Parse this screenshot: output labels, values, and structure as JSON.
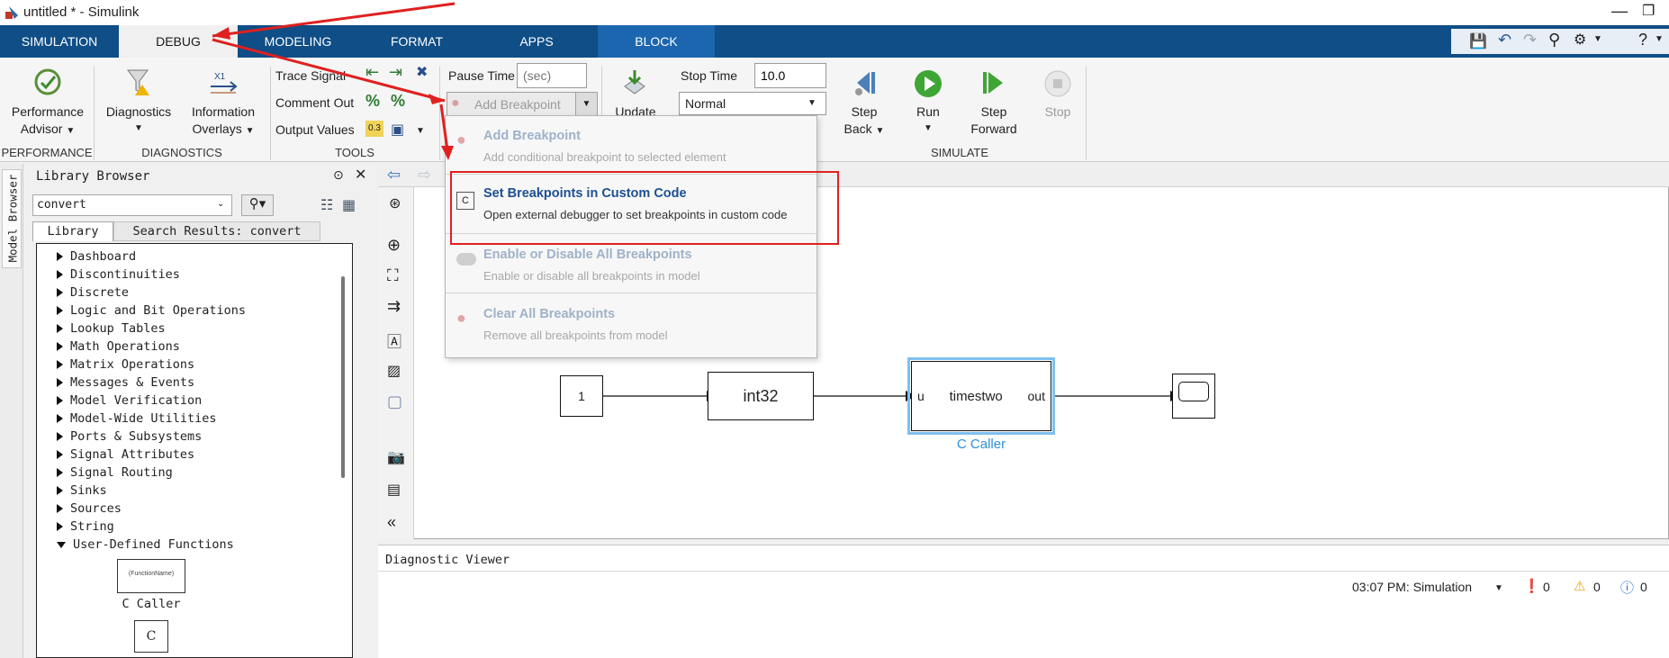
{
  "window": {
    "title": "untitled * - Simulink"
  },
  "tabs": [
    {
      "label": "SIMULATION"
    },
    {
      "label": "DEBUG"
    },
    {
      "label": "MODELING"
    },
    {
      "label": "FORMAT"
    },
    {
      "label": "APPS"
    },
    {
      "label": "BLOCK"
    }
  ],
  "ribbon": {
    "performance_advisor": "Performance\nAdvisor",
    "performance_advisor_l1": "Performance",
    "performance_advisor_l2": "Advisor",
    "diagnostics": "Diagnostics",
    "info_overlays_l1": "Information",
    "info_overlays_l2": "Overlays",
    "trace_signal": "Trace Signal",
    "comment_out": "Comment Out",
    "output_values": "Output Values",
    "pause_time_label": "Pause Time",
    "pause_time_placeholder": "(sec)",
    "add_breakpoint": "Add Breakpoint",
    "update": "Update",
    "stop_time_label": "Stop Time",
    "stop_time_value": "10.0",
    "sim_mode": "Normal",
    "step_back_l1": "Step",
    "step_back_l2": "Back",
    "run": "Run",
    "step_forward_l1": "Step",
    "step_forward_l2": "Forward",
    "stop": "Stop",
    "groups": {
      "performance": "PERFORMANCE",
      "diagnostics": "DIAGNOSTICS",
      "tools": "TOOLS",
      "simulate": "SIMULATE"
    }
  },
  "library": {
    "side_tab": "Model Browser",
    "title": "Library Browser",
    "search_value": "convert",
    "tab_library": "Library",
    "tab_search": "Search Results: convert",
    "items": [
      "Dashboard",
      "Discontinuities",
      "Discrete",
      "Logic and Bit Operations",
      "Lookup Tables",
      "Math Operations",
      "Matrix Operations",
      "Messages & Events",
      "Model Verification",
      "Model-Wide Utilities",
      "Ports & Subsystems",
      "Signal Attributes",
      "Signal Routing",
      "Sinks",
      "Sources",
      "String",
      "User-Defined Functions"
    ],
    "block_c_caller_inner": "(FunctionName)",
    "block_c_caller": "C Caller",
    "block_c": "C"
  },
  "menu": {
    "items": [
      {
        "title": "Add Breakpoint",
        "desc": "Add conditional breakpoint to selected element"
      },
      {
        "title": "Set Breakpoints in Custom Code",
        "desc": "Open external debugger to set breakpoints in custom code"
      },
      {
        "title": "Enable or Disable All Breakpoints",
        "desc": "Enable or disable all breakpoints in model"
      },
      {
        "title": "Clear All Breakpoints",
        "desc": "Remove all breakpoints from model"
      }
    ]
  },
  "model": {
    "constant": "1",
    "convert": "int32",
    "caller_in": "u",
    "caller_name": "timestwo",
    "caller_out": "out",
    "caller_label": "C Caller"
  },
  "diagnostic": {
    "title": "Diagnostic Viewer",
    "timestamp": "03:07 PM: Simulation",
    "errors": "0",
    "warnings": "0",
    "info": "0"
  },
  "colors": {
    "tabbar": "#0f4e86",
    "block_tab": "#1c66b0",
    "highlight": "#e02020",
    "selected_block": "#2f8fd8"
  }
}
